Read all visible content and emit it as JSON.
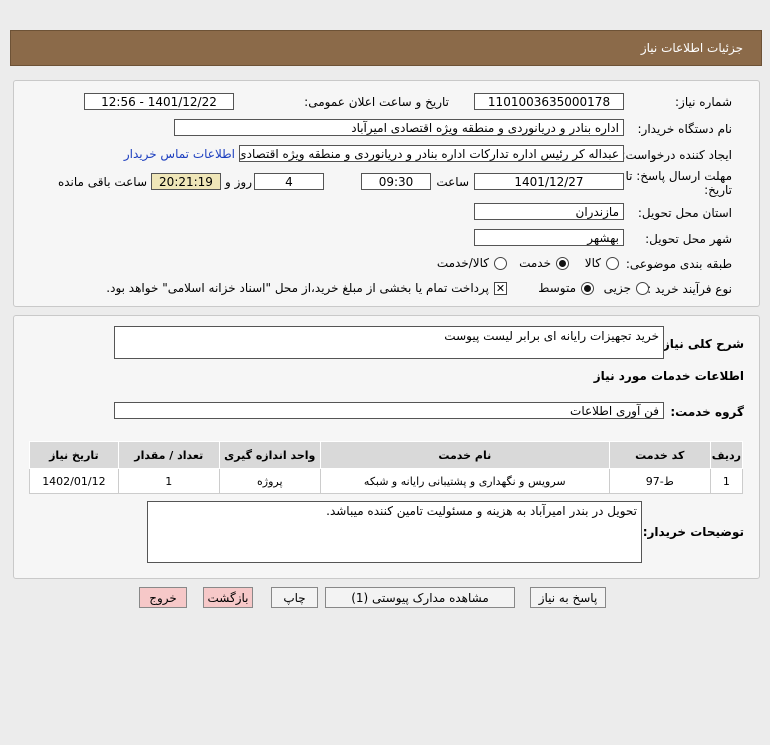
{
  "header": {
    "title": "جزئیات اطلاعات نیاز"
  },
  "form": {
    "need_number_label": "شماره نیاز:",
    "need_number": "1101003635000178",
    "announce_label": "تاریخ و ساعت اعلان عمومی:",
    "announce_value": "1401/12/22 - 12:56",
    "buyer_org_label": "نام دستگاه خریدار:",
    "buyer_org": "اداره بنادر و دریانوردی و منطقه ویژه اقتصادی امیرآباد",
    "creator_label": "ایجاد کننده درخواست:",
    "creator": "عبداله کر رئیس اداره تدارکات اداره بنادر و دریانوردی و منطقه ویژه اقتصادی امیرآباد",
    "contact_link": "اطلاعات تماس خریدار",
    "deadline_label": "مهلت ارسال پاسخ: تا",
    "deadline_label2": "تاریخ:",
    "deadline_date": "1401/12/27",
    "time_label": "ساعت",
    "deadline_time": "09:30",
    "days_value": "4",
    "days_label": "روز و",
    "remaining_time": "20:21:19",
    "remaining_label": "ساعت باقی مانده",
    "province_label": "استان محل تحویل:",
    "province": "مازندران",
    "city_label": "شهر محل تحویل:",
    "city": "بهشهر",
    "category_label": "طبقه بندی موضوعی:",
    "category_options": [
      "کالا",
      "خدمت",
      "کالا/خدمت"
    ],
    "process_label": "نوع فرآیند خرید :",
    "process_options": [
      "جزیی",
      "متوسط"
    ],
    "payment_note": "پرداخت تمام یا بخشی از مبلغ خرید،از محل \"اسناد خزانه اسلامی\" خواهد بود."
  },
  "details": {
    "summary_label": "شرح کلی نیاز:",
    "summary": "خرید تجهیزات رایانه ای برابر لیست پیوست",
    "services_heading": "اطلاعات خدمات مورد نیاز",
    "service_group_label": "گروه خدمت:",
    "service_group": "فن آوری اطلاعات",
    "table": {
      "headers": [
        "ردیف",
        "کد خدمت",
        "نام خدمت",
        "واحد اندازه گیری",
        "تعداد / مقدار",
        "تاریخ نیاز"
      ],
      "rows": [
        [
          "1",
          "ط-97",
          "سرویس و نگهداری و پشتیبانی رایانه و شبکه",
          "پروژه",
          "1",
          "1402/01/12"
        ]
      ]
    },
    "buyer_notes_label": "توضیحات خریدار:",
    "buyer_notes": "تحویل در بندر امیرآباد به هزینه و مسئولیت تامین کننده میباشد."
  },
  "buttons": {
    "reply": "پاسخ به نیاز",
    "attachments": "مشاهده مدارک پیوستی (1)",
    "print": "چاپ",
    "back": "بازگشت",
    "exit": "خروج"
  }
}
